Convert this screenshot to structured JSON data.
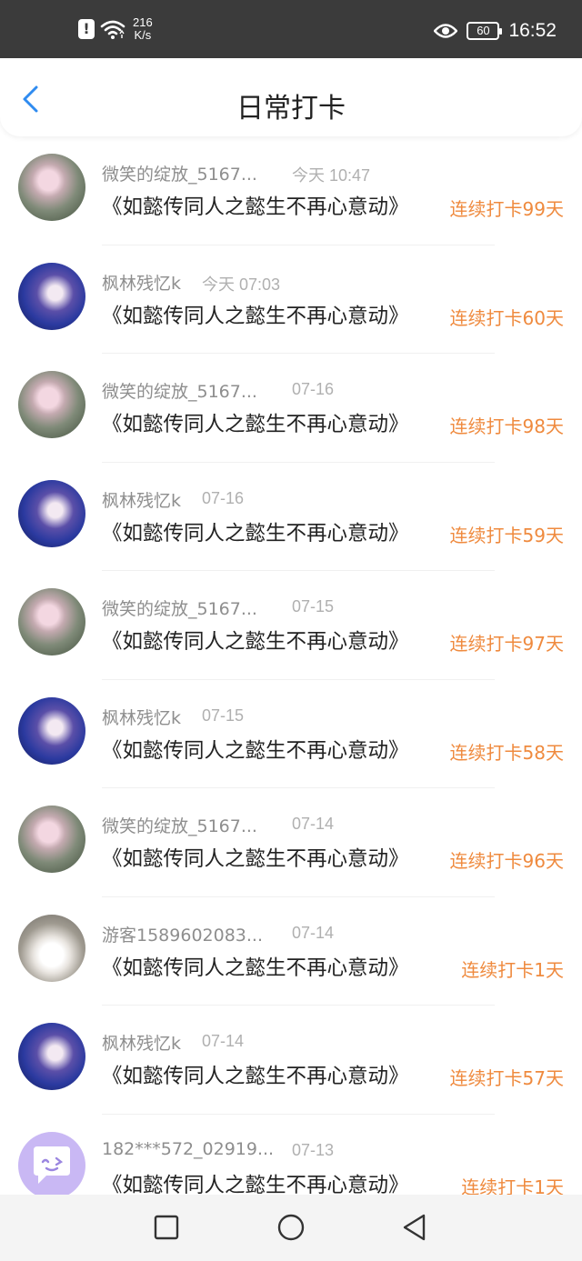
{
  "status_bar": {
    "alert_icon": "!",
    "net_speed_value": "216",
    "net_speed_unit": "K/s",
    "battery": "60",
    "time": "16:52"
  },
  "header": {
    "title": "日常打卡",
    "back_icon": "chevron-left-icon"
  },
  "colors": {
    "accent": "#ef8a3e",
    "back": "#2f8bf0"
  },
  "checkins": [
    {
      "avatar": "a",
      "name": "微笑的绽放_5167...",
      "date": "今天 10:47",
      "book": "《如懿传同人之懿生不再心意动》",
      "streak": "连续打卡99天"
    },
    {
      "avatar": "b",
      "name": "枫林残忆k",
      "date": "今天 07:03",
      "book": "《如懿传同人之懿生不再心意动》",
      "streak": "连续打卡60天"
    },
    {
      "avatar": "a",
      "name": "微笑的绽放_5167...",
      "date": "07-16",
      "book": "《如懿传同人之懿生不再心意动》",
      "streak": "连续打卡98天"
    },
    {
      "avatar": "b",
      "name": "枫林残忆k",
      "date": "07-16",
      "book": "《如懿传同人之懿生不再心意动》",
      "streak": "连续打卡59天"
    },
    {
      "avatar": "a",
      "name": "微笑的绽放_5167...",
      "date": "07-15",
      "book": "《如懿传同人之懿生不再心意动》",
      "streak": "连续打卡97天"
    },
    {
      "avatar": "b",
      "name": "枫林残忆k",
      "date": "07-15",
      "book": "《如懿传同人之懿生不再心意动》",
      "streak": "连续打卡58天"
    },
    {
      "avatar": "a",
      "name": "微笑的绽放_5167...",
      "date": "07-14",
      "book": "《如懿传同人之懿生不再心意动》",
      "streak": "连续打卡96天"
    },
    {
      "avatar": "c",
      "name": "游客1589602083...",
      "date": "07-14",
      "book": "《如懿传同人之懿生不再心意动》",
      "streak": "连续打卡1天"
    },
    {
      "avatar": "b",
      "name": "枫林残忆k",
      "date": "07-14",
      "book": "《如懿传同人之懿生不再心意动》",
      "streak": "连续打卡57天"
    },
    {
      "avatar": "d",
      "name": "182***572_02919...",
      "date": "07-13",
      "book": "《如懿传同人之懿生不再心意动》",
      "streak": "连续打卡1天"
    }
  ],
  "nav_buttons": [
    "recent-apps-icon",
    "home-icon",
    "back-icon"
  ]
}
